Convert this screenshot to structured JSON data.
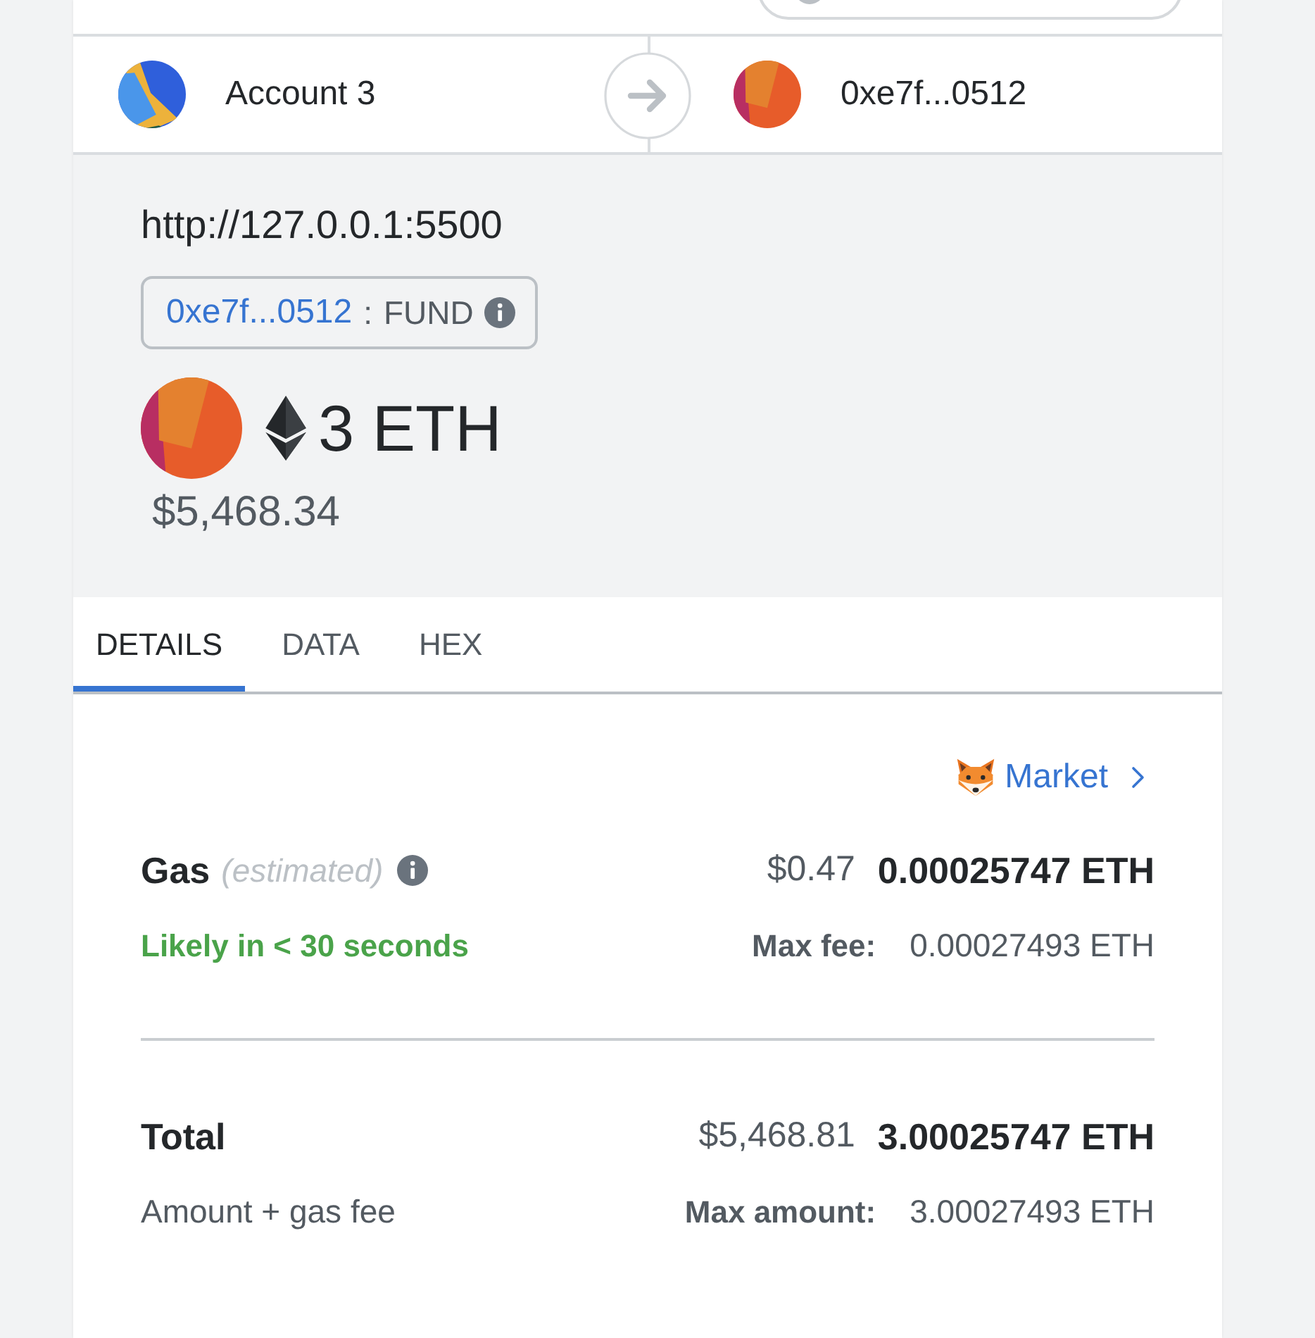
{
  "sender": {
    "name": "Account 3"
  },
  "recipient": {
    "name": "0xe7f...0512"
  },
  "origin": "http://127.0.0.1:5500",
  "method": {
    "address": "0xe7f...0512",
    "separator": ":",
    "name": "FUND"
  },
  "amount": {
    "value": "3 ETH",
    "fiat": "$5,468.34"
  },
  "tabs": [
    {
      "label": "DETAILS",
      "selected": true
    },
    {
      "label": "DATA",
      "selected": false
    },
    {
      "label": "HEX",
      "selected": false
    }
  ],
  "market_link": {
    "label": "Market"
  },
  "gas": {
    "label": "Gas",
    "note": "(estimated)",
    "fiat": "$0.47",
    "value": "0.00025747 ETH",
    "timing": "Likely in < 30 seconds",
    "max_label": "Max fee:",
    "max_value": "0.00027493 ETH"
  },
  "total": {
    "label": "Total",
    "fiat": "$5,468.81",
    "value": "3.00025747 ETH",
    "caption": "Amount + gas fee",
    "max_label": "Max amount:",
    "max_value": "3.00027493 ETH"
  }
}
